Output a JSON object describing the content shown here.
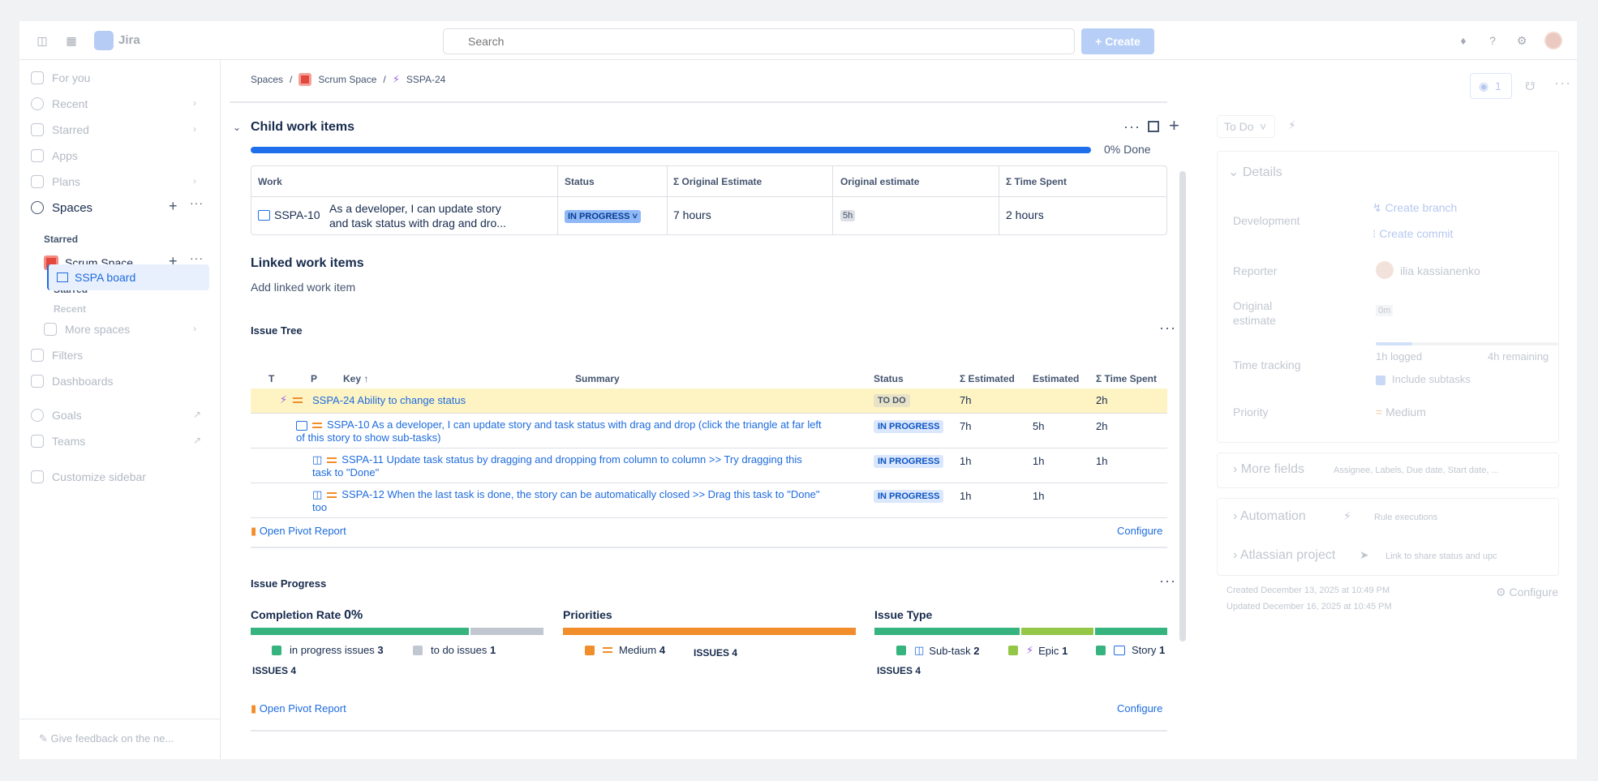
{
  "header": {
    "brand": "Jira",
    "search_placeholder": "Search",
    "create_label": "Create"
  },
  "sidebar": {
    "items": [
      {
        "label": "For you"
      },
      {
        "label": "Recent"
      },
      {
        "label": "Starred"
      },
      {
        "label": "Apps"
      },
      {
        "label": "Plans"
      }
    ],
    "spaces_label": "Spaces",
    "starred_label": "Starred",
    "scrum_space": "Scrum Space",
    "starred_sub": "Starred",
    "board": "SSPA board",
    "recent_sub": "Recent",
    "more_spaces": "More spaces",
    "filters": "Filters",
    "dashboards": "Dashboards",
    "goals": "Goals",
    "teams": "Teams",
    "customize": "Customize sidebar",
    "feedback": "Give feedback on the ne..."
  },
  "breadcrumb": {
    "spaces": "Spaces",
    "space": "Scrum Space",
    "key": "SSPA-24"
  },
  "child_items": {
    "title": "Child work items",
    "progress_label": "0% Done",
    "headers": [
      "Work",
      "Status",
      "Σ Original Estimate",
      "Original estimate",
      "Σ Time Spent"
    ],
    "row": {
      "key": "SSPA-10",
      "summary_line1": "As a developer, I can update story",
      "summary_line2": "and task status with drag and dro...",
      "status": "IN PROGRESS",
      "sum_estimate": "7 hours",
      "estimate": "5h",
      "time_spent": "2 hours"
    }
  },
  "linked": {
    "title": "Linked work items",
    "add": "Add linked work item"
  },
  "issue_tree": {
    "title": "Issue Tree",
    "headers": {
      "t": "T",
      "p": "P",
      "key": "Key",
      "summary": "Summary",
      "status": "Status",
      "sum_est": "Σ Estimated",
      "est": "Estimated",
      "spent": "Σ Time Spent"
    },
    "rows": [
      {
        "text": "SSPA-24 Ability to change status",
        "status": "TO DO",
        "sum_est": "7h",
        "est": "",
        "spent": "2h"
      },
      {
        "text1": "SSPA-10 As a developer, I can update story and task status with drag and drop (click the triangle at far left",
        "text2": "of this story to show sub-tasks)",
        "status": "IN PROGRESS",
        "sum_est": "7h",
        "est": "5h",
        "spent": "2h"
      },
      {
        "text1": "SSPA-11 Update task status by dragging and dropping from column to column >> Try dragging this",
        "text2": "task to \"Done\"",
        "status": "IN PROGRESS",
        "sum_est": "1h",
        "est": "1h",
        "spent": "1h"
      },
      {
        "text1": "SSPA-12 When the last task is done, the story can be automatically closed >> Drag this task to \"Done\"",
        "text2": "too",
        "status": "IN PROGRESS",
        "sum_est": "1h",
        "est": "1h",
        "spent": ""
      }
    ],
    "open_report": "Open Pivot Report",
    "configure": "Configure"
  },
  "issue_progress": {
    "title": "Issue Progress",
    "completion_label": "Completion Rate",
    "completion_value": "0%",
    "completion_segments": [
      {
        "name": "in progress issues",
        "count": "3",
        "color": "#36b37e",
        "fraction": 0.75
      },
      {
        "name": "to do issues",
        "count": "1",
        "color": "#c1c7d0",
        "fraction": 0.25
      }
    ],
    "issues_label": "ISSUES",
    "completion_total": "4",
    "priorities_label": "Priorities",
    "priority": {
      "name": "Medium",
      "count": "4",
      "color": "#f18d2a"
    },
    "priorities_total": "4",
    "type_label": "Issue Type",
    "types": [
      {
        "name": "Sub-task",
        "count": "2",
        "color": "#36b37e",
        "fraction": 0.5
      },
      {
        "name": "Epic",
        "count": "1",
        "color": "#94c748",
        "fraction": 0.25
      },
      {
        "name": "Story",
        "count": "1",
        "color": "#36b37e",
        "fraction": 0.25
      }
    ],
    "types_total": "4",
    "open_report": "Open Pivot Report",
    "configure": "Configure"
  },
  "right_panel": {
    "watch_count": "1",
    "status": "To Do",
    "details_title": "Details",
    "development_label": "Development",
    "create_branch": "Create branch",
    "create_commit": "Create commit",
    "reporter_label": "Reporter",
    "reporter": "ilia kassianenko",
    "orig_est_label1": "Original",
    "orig_est_label2": "estimate",
    "orig_est": "0m",
    "time_tracking_label": "Time tracking",
    "logged": "1h logged",
    "remaining": "4h remaining",
    "include_subtasks": "Include subtasks",
    "priority_label": "Priority",
    "priority": "Medium",
    "more_fields": "More fields",
    "more_fields_hint": "Assignee, Labels, Due date, Start date, ...",
    "automation": "Automation",
    "automation_hint": "Rule executions",
    "atlassian": "Atlassian project",
    "atlassian_hint": "Link to share status and upc",
    "created": "Created December 13, 2025 at 10:49 PM",
    "updated": "Updated December 16, 2025 at 10:45 PM",
    "configure": "Configure"
  }
}
